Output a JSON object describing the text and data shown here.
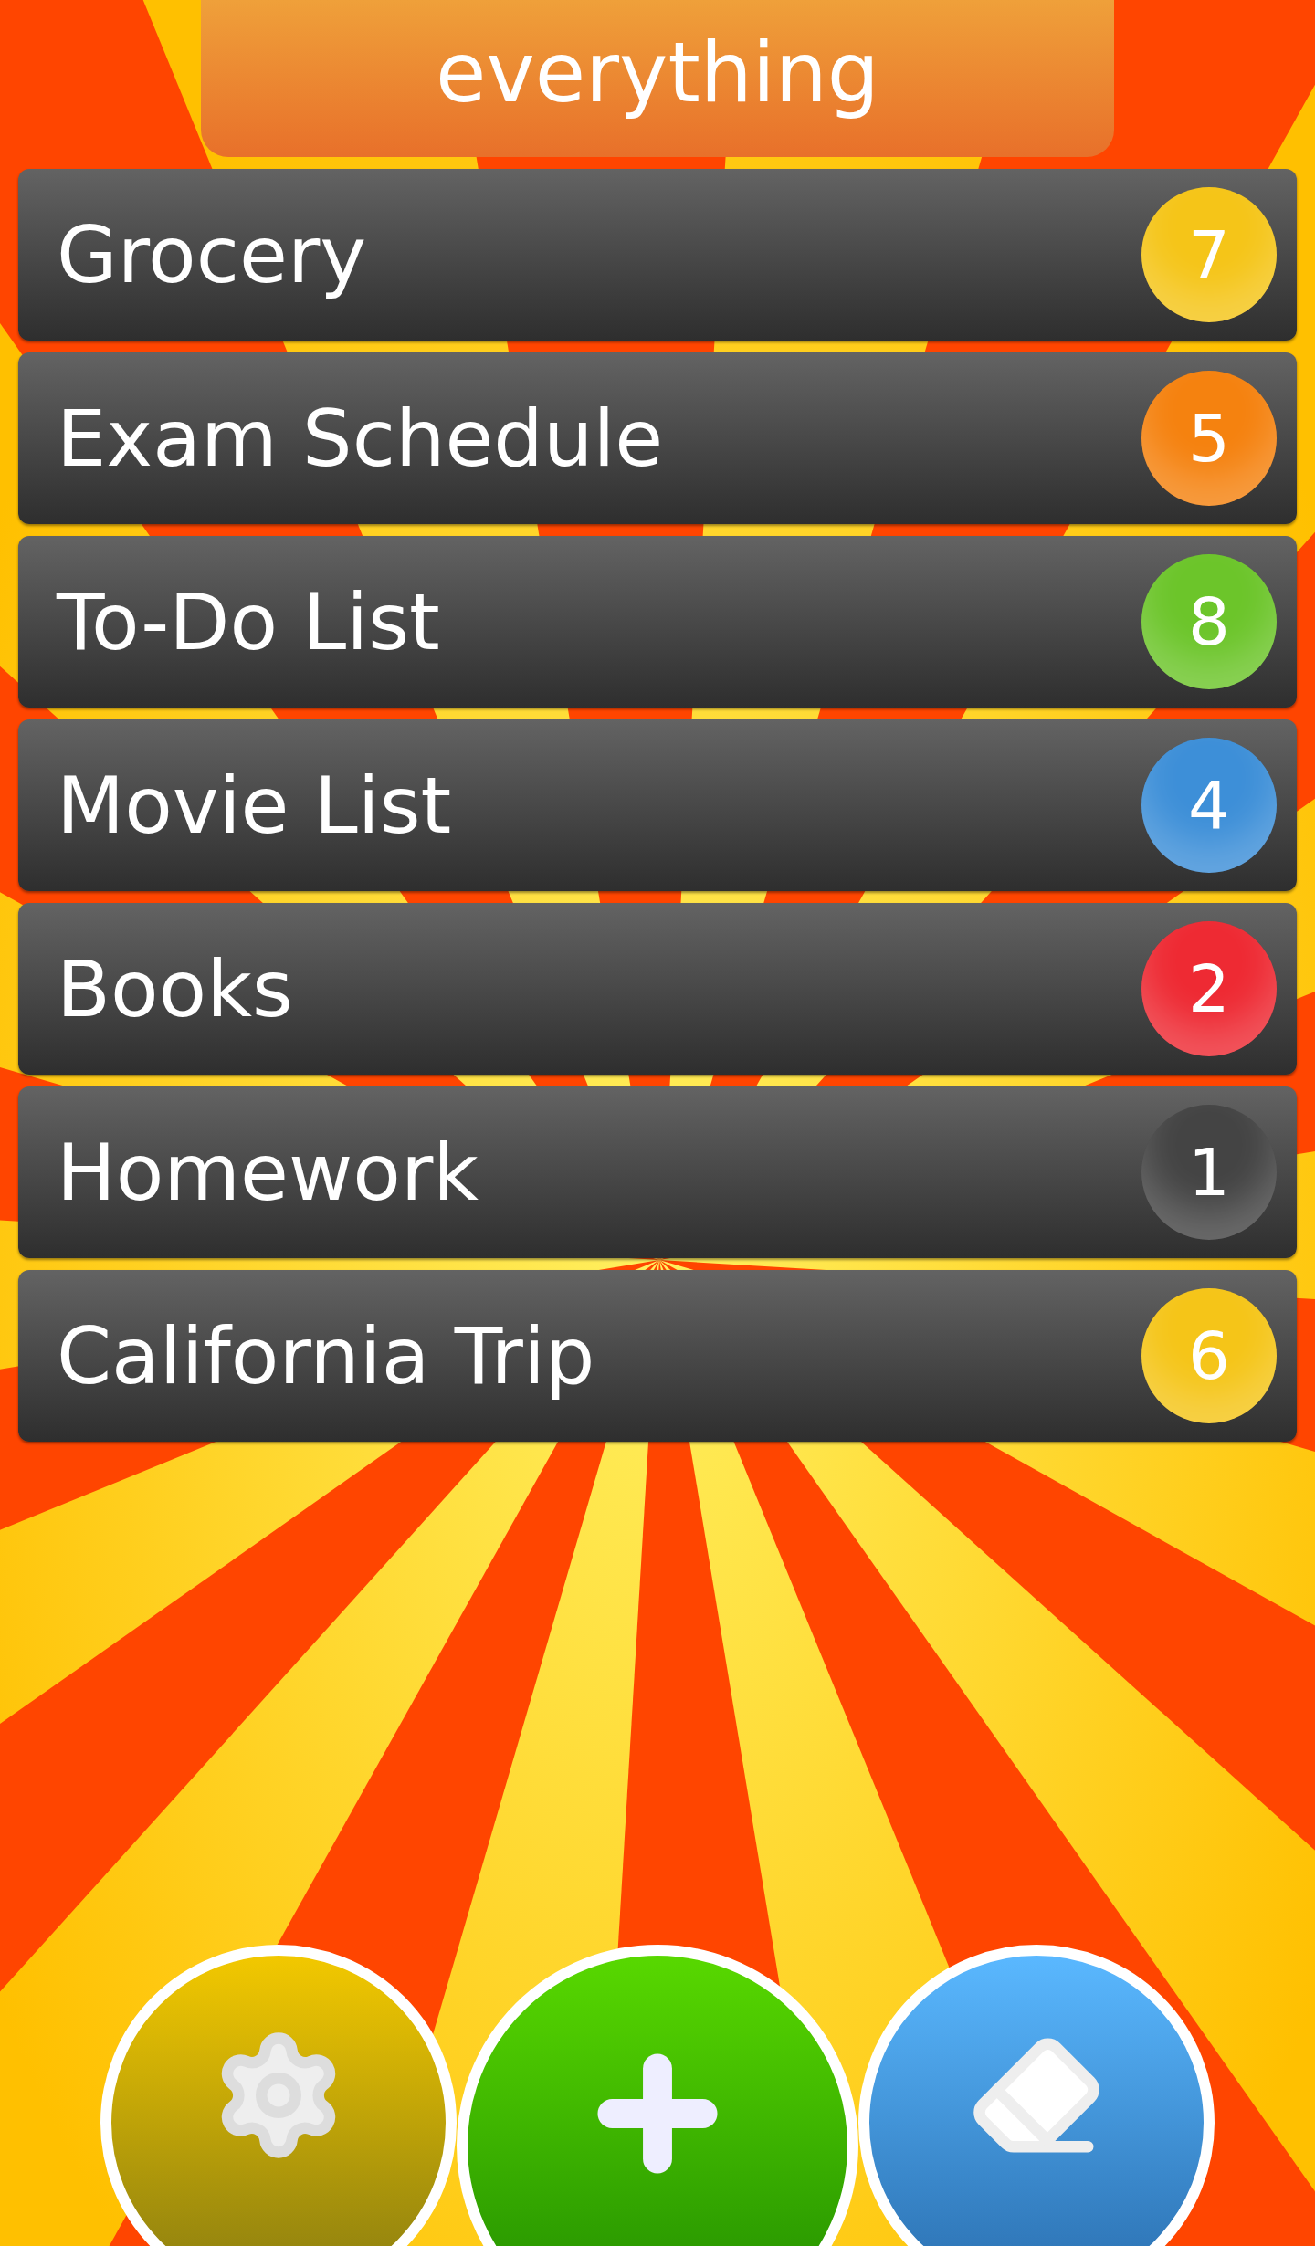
{
  "header": {
    "title": "everything"
  },
  "lists": [
    {
      "name": "Grocery",
      "count": "7",
      "color": "#f5c518"
    },
    {
      "name": "Exam Schedule",
      "count": "5",
      "color": "#f5820f"
    },
    {
      "name": "To-Do List",
      "count": "8",
      "color": "#6cc52a"
    },
    {
      "name": "Movie List",
      "count": "4",
      "color": "#3d8fd8"
    },
    {
      "name": "Books",
      "count": "2",
      "color": "#ee2a33"
    },
    {
      "name": "Homework",
      "count": "1",
      "color": "#444444"
    },
    {
      "name": "California Trip",
      "count": "6",
      "color": "#f5c518"
    }
  ],
  "actions": [
    {
      "kind": "settings"
    },
    {
      "kind": "add"
    },
    {
      "kind": "erase"
    }
  ]
}
